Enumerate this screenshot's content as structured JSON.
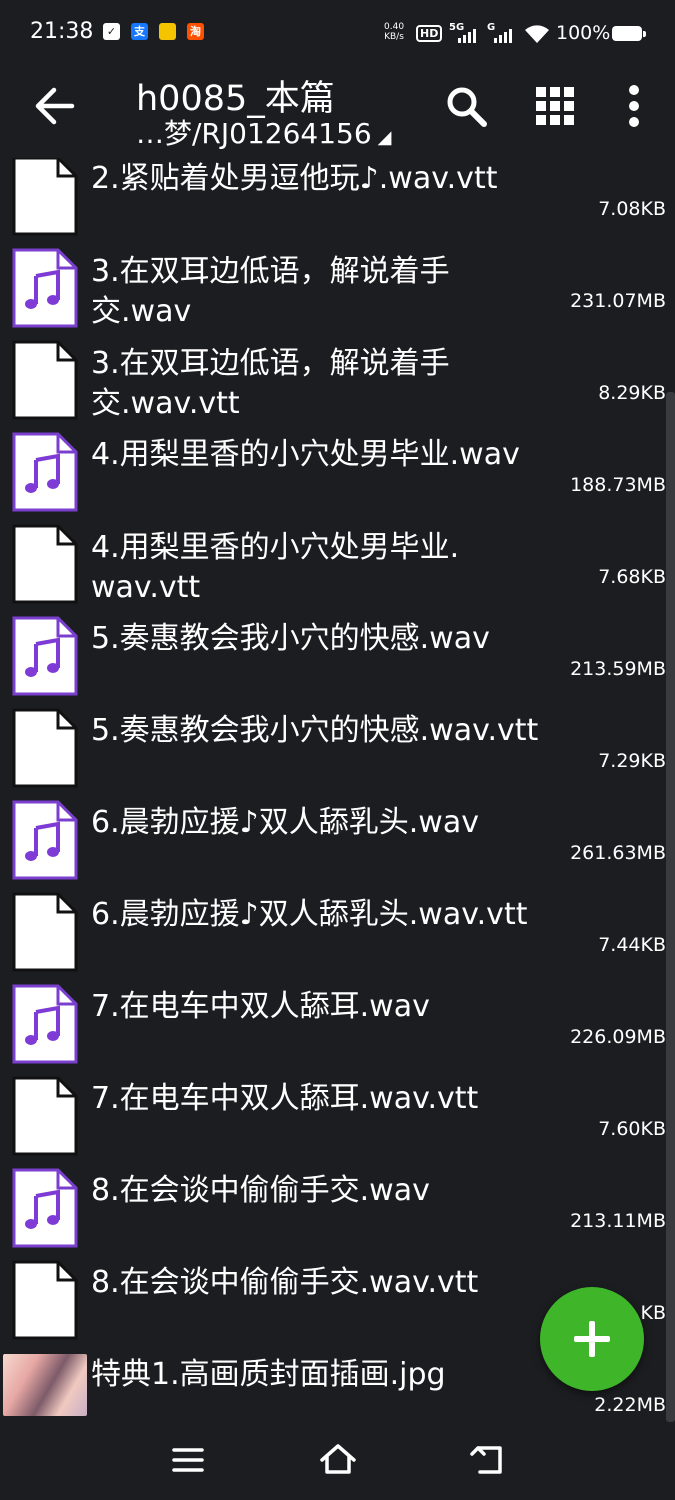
{
  "status_bar": {
    "time": "21:38",
    "notif_icons": [
      "check-icon",
      "alipay-icon",
      "notification-icon",
      "taobao-icon"
    ],
    "alipay_glyph": "支",
    "taobao_glyph": "淘",
    "net_speed_value": "0.40",
    "net_speed_unit": "KB/s",
    "hd_badge": "HD",
    "network_5g": "5G",
    "network_g": "G",
    "battery_percent": "100%"
  },
  "app_bar": {
    "title": "h0085_本篇",
    "path": "…梦/RJ01264156",
    "path_dropdown_glyph": "◢"
  },
  "files": [
    {
      "name": "2.紧贴着处男逗他玩♪.wav.vtt",
      "size": "7.08KB",
      "type": "document"
    },
    {
      "name": "3.在双耳边低语，解说着手交.wav",
      "size": "231.07MB",
      "type": "audio"
    },
    {
      "name": "3.在双耳边低语，解说着手交.wav.vtt",
      "size": "8.29KB",
      "type": "document"
    },
    {
      "name": "4.用梨里香的小穴处男毕业.wav",
      "size": "188.73MB",
      "type": "audio"
    },
    {
      "name": "4.用梨里香的小穴处男毕业.wav.vtt",
      "size": "7.68KB",
      "type": "document"
    },
    {
      "name": "5.奏惠教会我小穴的快感.wav",
      "size": "213.59MB",
      "type": "audio"
    },
    {
      "name": "5.奏惠教会我小穴的快感.wav.vtt",
      "size": "7.29KB",
      "type": "document"
    },
    {
      "name": "6.晨勃应援♪双人舔乳头.wav",
      "size": "261.63MB",
      "type": "audio"
    },
    {
      "name": "6.晨勃应援♪双人舔乳头.wav.vtt",
      "size": "7.44KB",
      "type": "document"
    },
    {
      "name": "7.在电车中双人舔耳.wav",
      "size": "226.09MB",
      "type": "audio"
    },
    {
      "name": "7.在电车中双人舔耳.wav.vtt",
      "size": "7.60KB",
      "type": "document"
    },
    {
      "name": "8.在会谈中偷偷手交.wav",
      "size": "213.11MB",
      "type": "audio"
    },
    {
      "name": "8.在会谈中偷偷手交.wav.vtt",
      "size": "KB",
      "type": "document"
    },
    {
      "name": "特典1.高画质封面插画.jpg",
      "size": "2.22MB",
      "type": "image"
    }
  ],
  "fab": {
    "icon": "plus-icon",
    "color": "#3fb52a"
  },
  "nav_bar": {
    "icons": [
      "menu-icon",
      "home-icon",
      "back-icon"
    ]
  },
  "colors": {
    "background": "#1c1d20",
    "audio_icon_border": "#7b3fcf",
    "music_note": "#7e3bd6"
  }
}
